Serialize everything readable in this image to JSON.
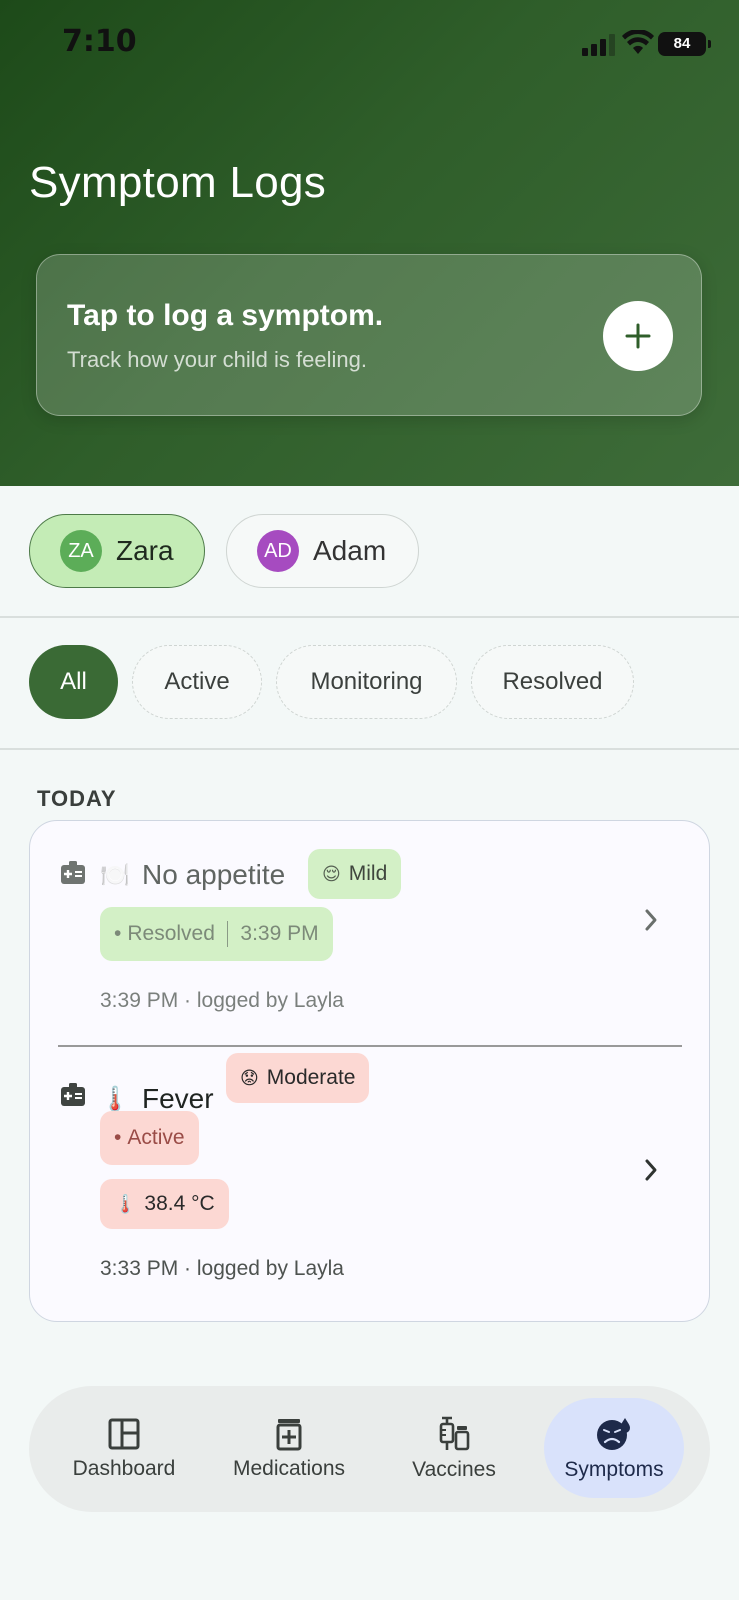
{
  "status_bar": {
    "time": "7:10",
    "battery": "84"
  },
  "header": {
    "title": "Symptom Logs",
    "log_card": {
      "title": "Tap to log a symptom.",
      "subtitle": "Track how your child is feeling."
    }
  },
  "children": [
    {
      "initials": "ZA",
      "name": "Zara",
      "selected": true,
      "avatar_color": "#5cad58"
    },
    {
      "initials": "AD",
      "name": "Adam",
      "selected": false,
      "avatar_color": "#a64bc0"
    }
  ],
  "filters": [
    {
      "label": "All",
      "active": true
    },
    {
      "label": "Active",
      "active": false
    },
    {
      "label": "Monitoring",
      "active": false
    },
    {
      "label": "Resolved",
      "active": false
    }
  ],
  "section_label": "TODAY",
  "entries": [
    {
      "emoji": "🍽️",
      "name": "No appetite",
      "severity_emoji": "😌",
      "severity": "Mild",
      "status": "Resolved",
      "status_time": "3:39 PM",
      "meta": "3:39 PM · logged by Layla"
    },
    {
      "emoji": "🌡️",
      "name": "Fever",
      "severity_emoji": "😟",
      "severity": "Moderate",
      "status": "Active",
      "temperature": "38.4 °C",
      "meta": "3:33 PM · logged by Layla"
    }
  ],
  "nav": [
    {
      "label": "Dashboard",
      "icon": "dashboard-icon",
      "active": false
    },
    {
      "label": "Medications",
      "icon": "medication-icon",
      "active": false
    },
    {
      "label": "Vaccines",
      "icon": "vaccine-icon",
      "active": false
    },
    {
      "label": "Symptoms",
      "icon": "symptoms-icon",
      "active": true
    }
  ],
  "colors": {
    "brand": "#3a6a35",
    "mild": "#d3f0c6",
    "active_red": "#fcd8d3",
    "nav_active": "#d9e2fb"
  }
}
